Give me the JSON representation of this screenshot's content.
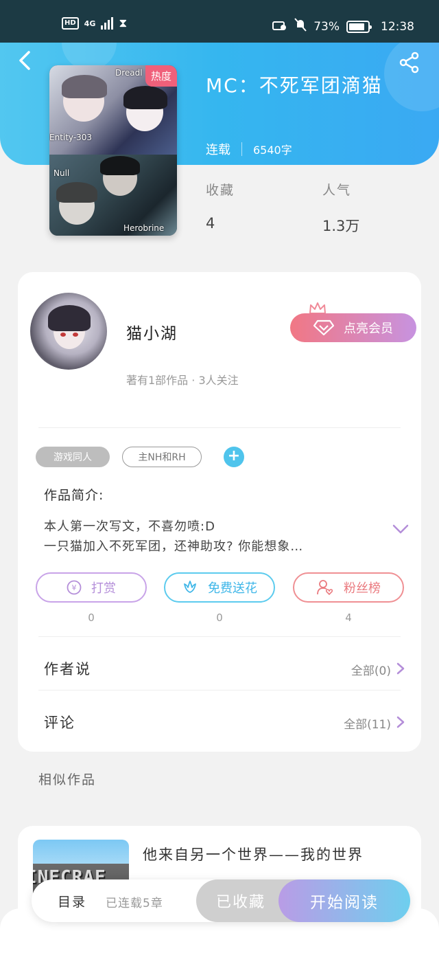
{
  "status_bar": {
    "hd": "HD",
    "network": "4G",
    "battery": "73%",
    "time": "12:38"
  },
  "book": {
    "title": "MC：不死军团滴猫",
    "status": "连载",
    "word_count": "6540字",
    "hot_badge": "热度",
    "cover_labels": [
      "Dreadl",
      "Entity-303",
      "Null",
      "Herobrine"
    ]
  },
  "stats": [
    {
      "label": "收藏",
      "value": "4"
    },
    {
      "label": "人气",
      "value": "1.3万"
    }
  ],
  "author": {
    "name": "猫小湖",
    "subtitle": "著有1部作品 · 3人关注",
    "vip_button": "点亮会员"
  },
  "tags": [
    "游戏同人",
    "主NH和RH"
  ],
  "intro": {
    "title": "作品简介:",
    "line1": "本人第一次写文，不喜勿喷:D",
    "line2": "一只猫加入不死军团，还神助攻? 你能想象…"
  },
  "actions": [
    {
      "label": "打赏",
      "count": "0",
      "icon": "yen-icon"
    },
    {
      "label": "免费送花",
      "count": "0",
      "icon": "flower-icon"
    },
    {
      "label": "粉丝榜",
      "count": "4",
      "icon": "fan-user-icon"
    }
  ],
  "author_says": {
    "label": "作者说",
    "value": "全部(0)"
  },
  "comments": {
    "label": "评论",
    "value": "全部(11)"
  },
  "similar": {
    "title": "相似作品",
    "item_name": "他来自另一个世界——我的世界",
    "thumb_text": "INECRAF"
  },
  "bottom": {
    "toc": "目录",
    "toc_sub": "已连载5章",
    "fav_button": "已收藏",
    "read_button": "开始阅读"
  },
  "colors": {
    "header": "#35b6ef",
    "vip_start": "#f17784",
    "vip_end": "#c793e0",
    "accent_blue": "#4fc4ec"
  }
}
